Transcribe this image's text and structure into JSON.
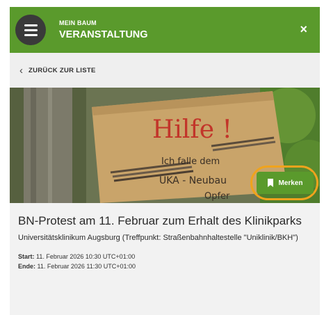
{
  "header": {
    "small_title": "MEIN BAUM",
    "big_title": "VERANSTALTUNG",
    "close_symbol": "×",
    "menu_icon": "hamburger-icon",
    "colors": {
      "header_bg": "#5a9a2c",
      "menu_button": "#3a3a3a"
    }
  },
  "back": {
    "label": "ZURÜCK ZUR LISTE",
    "chevron": "‹"
  },
  "hero": {
    "sign_text": [
      "Hilfe !",
      "Ich falle dem",
      "UKA - Neubau",
      "Opfer"
    ]
  },
  "merken": {
    "label": "Merken",
    "icon": "bookmark-icon",
    "highlight_color": "#f0a31c"
  },
  "event": {
    "title": "BN-Protest am 11. Februar zum Erhalt des Klinikparks",
    "location": "Universitätsklinikum Augsburg (Treffpunkt: Straßenbahnhaltestelle \"Uniklinik/BKH\")",
    "start_label": "Start:",
    "start_value": "11. Februar 2026 10:30 UTC+01:00",
    "end_label": "Ende:",
    "end_value": "11. Februar 2026 11:30 UTC+01:00"
  }
}
